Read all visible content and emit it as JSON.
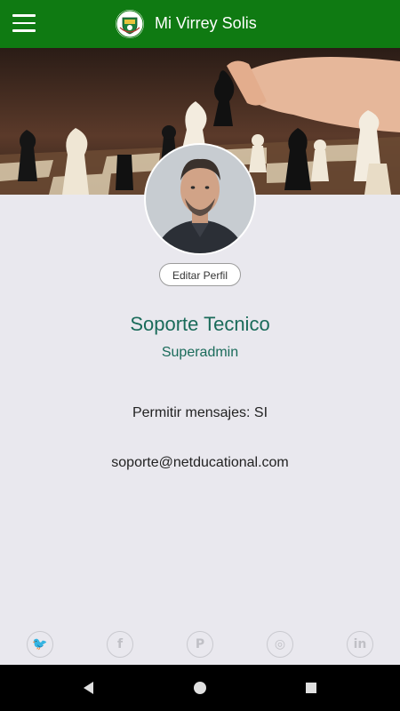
{
  "appbar": {
    "title": "Mi Virrey Solis",
    "menu_icon": "hamburger-menu-icon",
    "logo_icon": "school-crest-icon"
  },
  "profile": {
    "edit_label": "Editar Perfil",
    "name": "Soporte Tecnico",
    "role": "Superadmin",
    "messages_label": "Permitir mensajes: SI",
    "email": "soporte@netducational.com"
  },
  "social": [
    {
      "icon": "twitter-icon",
      "glyph": "🐦"
    },
    {
      "icon": "facebook-icon",
      "glyph": "f"
    },
    {
      "icon": "pinterest-icon",
      "glyph": "P"
    },
    {
      "icon": "instagram-icon",
      "glyph": "◎"
    },
    {
      "icon": "linkedin-icon",
      "glyph": "in"
    }
  ],
  "colors": {
    "appbar": "#0f7a12",
    "accent_text": "#1a6b5a",
    "background": "#e9e8ee"
  }
}
